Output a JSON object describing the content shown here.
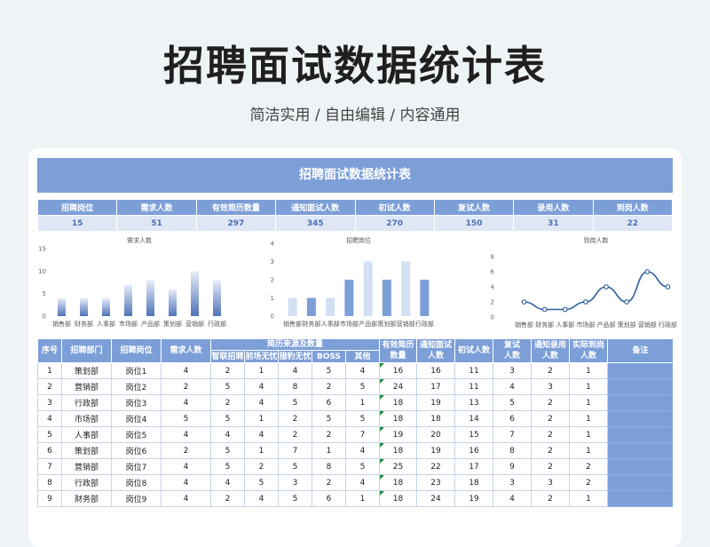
{
  "page": {
    "title": "招聘面试数据统计表",
    "subtitle": "简洁实用 / 自由编辑 / 内容通用"
  },
  "banner": {
    "title": "招聘面试数据统计表"
  },
  "summary": {
    "headers": [
      "招聘岗位",
      "需求人数",
      "有效简历数量",
      "通知面试人数",
      "初试人数",
      "复试人数",
      "录用人数",
      "到岗人数"
    ],
    "values": [
      "15",
      "51",
      "297",
      "345",
      "270",
      "150",
      "31",
      "22"
    ]
  },
  "chart_data": [
    {
      "type": "bar",
      "title": "需求人数",
      "categories": [
        "销售部",
        "财务部",
        "人事部",
        "市场部",
        "产品部",
        "策划部",
        "营销部",
        "行政部"
      ],
      "values": [
        4,
        4,
        4,
        7,
        8,
        6,
        10,
        8
      ],
      "ylim": [
        0,
        15
      ],
      "yticks": [
        0,
        5,
        10,
        15
      ],
      "style": "gradient-blue"
    },
    {
      "type": "bar",
      "title": "招聘岗位",
      "categories": [
        "销售部",
        "财务部",
        "人事部",
        "市场部",
        "产品部",
        "策划部",
        "营销部",
        "行政部"
      ],
      "values": [
        1,
        1,
        1,
        2,
        3,
        2,
        3,
        2
      ],
      "ylim": [
        0,
        4
      ],
      "yticks": [
        0,
        1,
        2,
        3,
        4
      ],
      "colors": [
        "#d3dff3",
        "#7d9fd8",
        "#d3dff3",
        "#7d9fd8",
        "#d3dff3",
        "#7d9fd8",
        "#d3dff3",
        "#7d9fd8"
      ]
    },
    {
      "type": "line",
      "title": "到岗人数",
      "categories": [
        "销售部",
        "财务部",
        "人事部",
        "市场部",
        "产品部",
        "策划部",
        "营销部",
        "行政部"
      ],
      "values": [
        2,
        1,
        1,
        2,
        4,
        2,
        6,
        4
      ],
      "ylim": [
        0,
        8
      ],
      "yticks": [
        0,
        2,
        4,
        6,
        8
      ],
      "color": "#2f5f9f"
    }
  ],
  "table": {
    "header_top": [
      "序号",
      "招聘部门",
      "招聘岗位",
      "需求人数",
      "简历来源及数量",
      "有效简历",
      "通知面试",
      "初试人数",
      "复试",
      "通知录用",
      "实际到岗",
      "备注"
    ],
    "header_top2": [
      "数量",
      "人数",
      "人数",
      "人数",
      "人数"
    ],
    "sources": [
      "智联招聘",
      "前场无忧",
      "猎豹无忧",
      "BOSS",
      "其他"
    ],
    "rows": [
      [
        "1",
        "策划部",
        "岗位1",
        "4",
        "2",
        "1",
        "4",
        "5",
        "4",
        "16",
        "16",
        "11",
        "3",
        "2",
        "1",
        ""
      ],
      [
        "2",
        "营销部",
        "岗位2",
        "2",
        "5",
        "4",
        "8",
        "2",
        "5",
        "24",
        "17",
        "11",
        "4",
        "3",
        "1",
        ""
      ],
      [
        "3",
        "行政部",
        "岗位3",
        "4",
        "2",
        "4",
        "5",
        "6",
        "1",
        "18",
        "19",
        "13",
        "5",
        "2",
        "1",
        ""
      ],
      [
        "4",
        "市场部",
        "岗位4",
        "5",
        "5",
        "1",
        "2",
        "5",
        "5",
        "18",
        "18",
        "14",
        "6",
        "2",
        "1",
        ""
      ],
      [
        "5",
        "人事部",
        "岗位5",
        "4",
        "4",
        "4",
        "2",
        "2",
        "7",
        "19",
        "20",
        "15",
        "7",
        "2",
        "1",
        ""
      ],
      [
        "6",
        "策划部",
        "岗位6",
        "2",
        "5",
        "1",
        "7",
        "1",
        "4",
        "18",
        "19",
        "16",
        "8",
        "2",
        "1",
        ""
      ],
      [
        "7",
        "营销部",
        "岗位7",
        "4",
        "5",
        "2",
        "5",
        "8",
        "5",
        "25",
        "22",
        "17",
        "9",
        "2",
        "2",
        ""
      ],
      [
        "8",
        "行政部",
        "岗位8",
        "4",
        "4",
        "5",
        "3",
        "2",
        "4",
        "18",
        "23",
        "18",
        "3",
        "3",
        "2",
        ""
      ],
      [
        "9",
        "财务部",
        "岗位9",
        "4",
        "2",
        "4",
        "5",
        "6",
        "1",
        "18",
        "24",
        "19",
        "4",
        "2",
        "1",
        ""
      ]
    ]
  }
}
